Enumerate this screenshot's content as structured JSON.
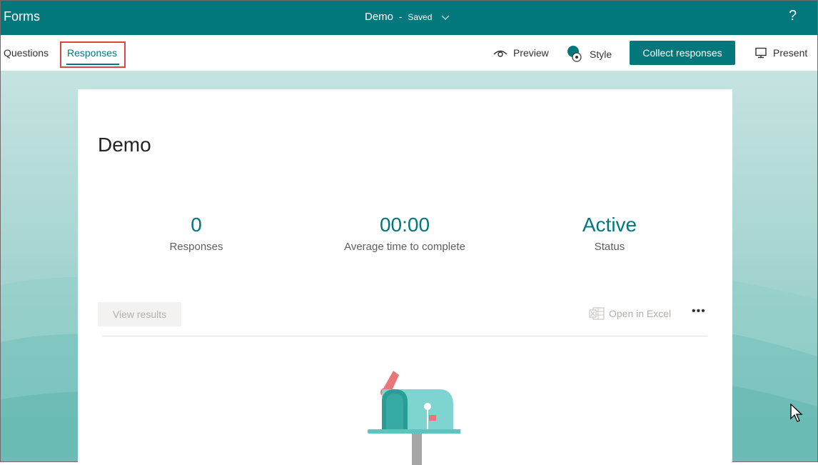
{
  "header": {
    "app_name": "Forms",
    "doc_title": "Demo",
    "separator": "-",
    "save_status": "Saved",
    "help_label": "?"
  },
  "tabs": {
    "questions": "Questions",
    "responses": "Responses"
  },
  "toolbar": {
    "preview": "Preview",
    "style": "Style",
    "collect": "Collect responses",
    "present": "Present"
  },
  "form": {
    "title": "Demo",
    "stats": [
      {
        "value": "0",
        "label": "Responses"
      },
      {
        "value": "00:00",
        "label": "Average time to complete"
      },
      {
        "value": "Active",
        "label": "Status"
      }
    ],
    "view_results": "View results",
    "open_in_excel": "Open in Excel",
    "more": "•••"
  },
  "colors": {
    "brand": "#03787c",
    "highlight": "#e04343"
  }
}
